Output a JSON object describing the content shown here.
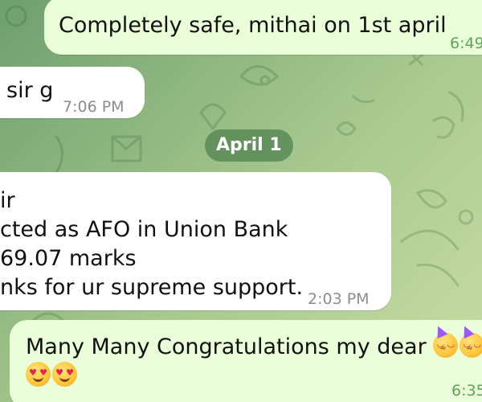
{
  "colors": {
    "outgoing_bubble": "#eaffd9",
    "incoming_bubble": "#ffffff",
    "outgoing_time": "#5fa356",
    "incoming_time": "#8c8c8c",
    "date_badge": "#4e804e"
  },
  "date_separator": "April 1",
  "messages": [
    {
      "direction": "outgoing",
      "lines": [
        "Completely safe, mithai on 1st april"
      ],
      "time": "6:49"
    },
    {
      "direction": "incoming",
      "lines": [
        "sir g"
      ],
      "time": "7:06 PM"
    },
    {
      "direction": "incoming",
      "lines": [
        "ir",
        "cted as AFO in Union Bank",
        "69.07 marks",
        "nks for ur supreme support."
      ],
      "time": "2:03 PM"
    },
    {
      "direction": "outgoing",
      "lines": [
        "Many Many Congratulations my dear"
      ],
      "emojis": [
        "partying-face-emoji",
        "partying-face-emoji",
        "heart-eyes-emoji",
        "heart-eyes-emoji"
      ],
      "time": "6:35"
    }
  ]
}
